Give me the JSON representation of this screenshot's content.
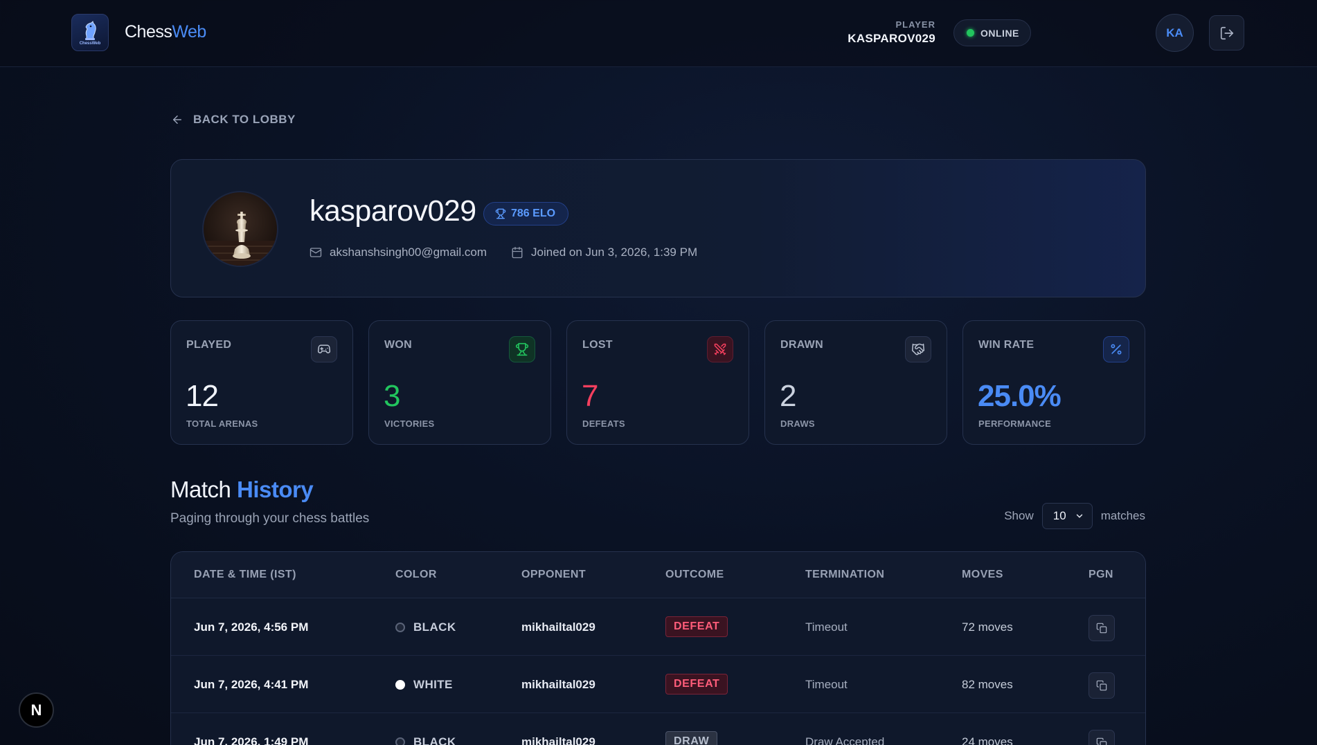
{
  "header": {
    "logo_mini": "ChessWeb",
    "brand_main": "Chess",
    "brand_accent": "Web",
    "status": "ONLINE",
    "player_label": "PLAYER",
    "player_name": "KASPAROV029",
    "avatar_initials": "KA"
  },
  "nav": {
    "back_label": "BACK TO LOBBY"
  },
  "profile": {
    "username": "kasparov029",
    "elo": "786 ELO",
    "email": "akshanshsingh00@gmail.com",
    "joined": "Joined on Jun 3, 2026, 1:39 PM"
  },
  "stats": [
    {
      "label": "PLAYED",
      "value": "12",
      "sub": "TOTAL ARENAS",
      "icon": "gamepad-icon",
      "color": "#f1f4fb"
    },
    {
      "label": "WON",
      "value": "3",
      "sub": "VICTORIES",
      "icon": "trophy-icon",
      "color": "#22c55e"
    },
    {
      "label": "LOST",
      "value": "7",
      "sub": "DEFEATS",
      "icon": "swords-icon",
      "color": "#f43f5e"
    },
    {
      "label": "DRAWN",
      "value": "2",
      "sub": "DRAWS",
      "icon": "handshake-icon",
      "color": "#cbd2df"
    },
    {
      "label": "WIN RATE",
      "value": "25.0%",
      "sub": "PERFORMANCE",
      "icon": "percent-icon",
      "color": "#4a8bf5"
    }
  ],
  "history": {
    "title_main": "Match",
    "title_accent": "History",
    "subtitle": "Paging through your chess battles",
    "show_label": "Show",
    "page_size": "10",
    "matches_label": "matches",
    "columns": [
      "DATE & TIME (IST)",
      "COLOR",
      "OPPONENT",
      "OUTCOME",
      "TERMINATION",
      "MOVES",
      "PGN"
    ],
    "rows": [
      {
        "date": "Jun 7, 2026, 4:56 PM",
        "color": "BLACK",
        "opponent": "mikhailtal029",
        "outcome": "DEFEAT",
        "termination": "Timeout",
        "moves": "72 moves"
      },
      {
        "date": "Jun 7, 2026, 4:41 PM",
        "color": "WHITE",
        "opponent": "mikhailtal029",
        "outcome": "DEFEAT",
        "termination": "Timeout",
        "moves": "82 moves"
      },
      {
        "date": "Jun 7, 2026, 1:49 PM",
        "color": "BLACK",
        "opponent": "mikhailtal029",
        "outcome": "DRAW",
        "termination": "Draw Accepted",
        "moves": "24 moves"
      }
    ]
  },
  "dev_badge": "N"
}
